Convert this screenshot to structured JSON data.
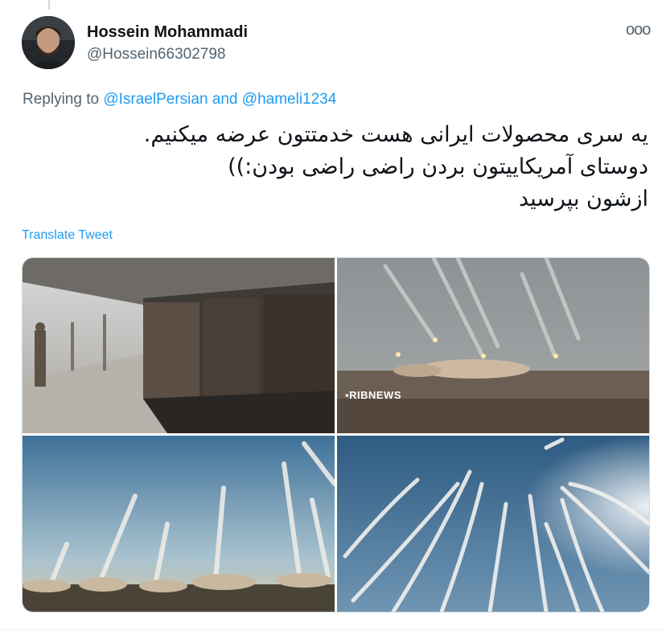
{
  "tweet": {
    "author_name": "Hossein Mohammadi",
    "author_handle": "@Hossein66302798",
    "more_icon": "more-horizontal-icon",
    "more_label": "ooo",
    "replying_prefix": "Replying to",
    "replying_user_1": "@IsraelPersian",
    "replying_and": "and",
    "replying_user_2": "@hameli1234",
    "text_lines": [
      "یه سری محصولات ایرانی هست خدمتتون عرضه میکنیم.",
      "دوستای آمریکاییتون بردن راضی راضی بودن:))",
      "ازشون بپرسید"
    ],
    "translate_label": "Translate Tweet",
    "media": [
      {
        "name": "photo-destroyed-hangar"
      },
      {
        "name": "photo-missile-launch-desert",
        "watermark": "▪RIBNEWS"
      },
      {
        "name": "photo-missile-trails-sunset"
      },
      {
        "name": "photo-missile-trails-sky"
      }
    ]
  },
  "colors": {
    "link": "#1d9bf0",
    "secondary_text": "#536471",
    "primary_text": "#0f1419",
    "border": "#cfd9de"
  }
}
